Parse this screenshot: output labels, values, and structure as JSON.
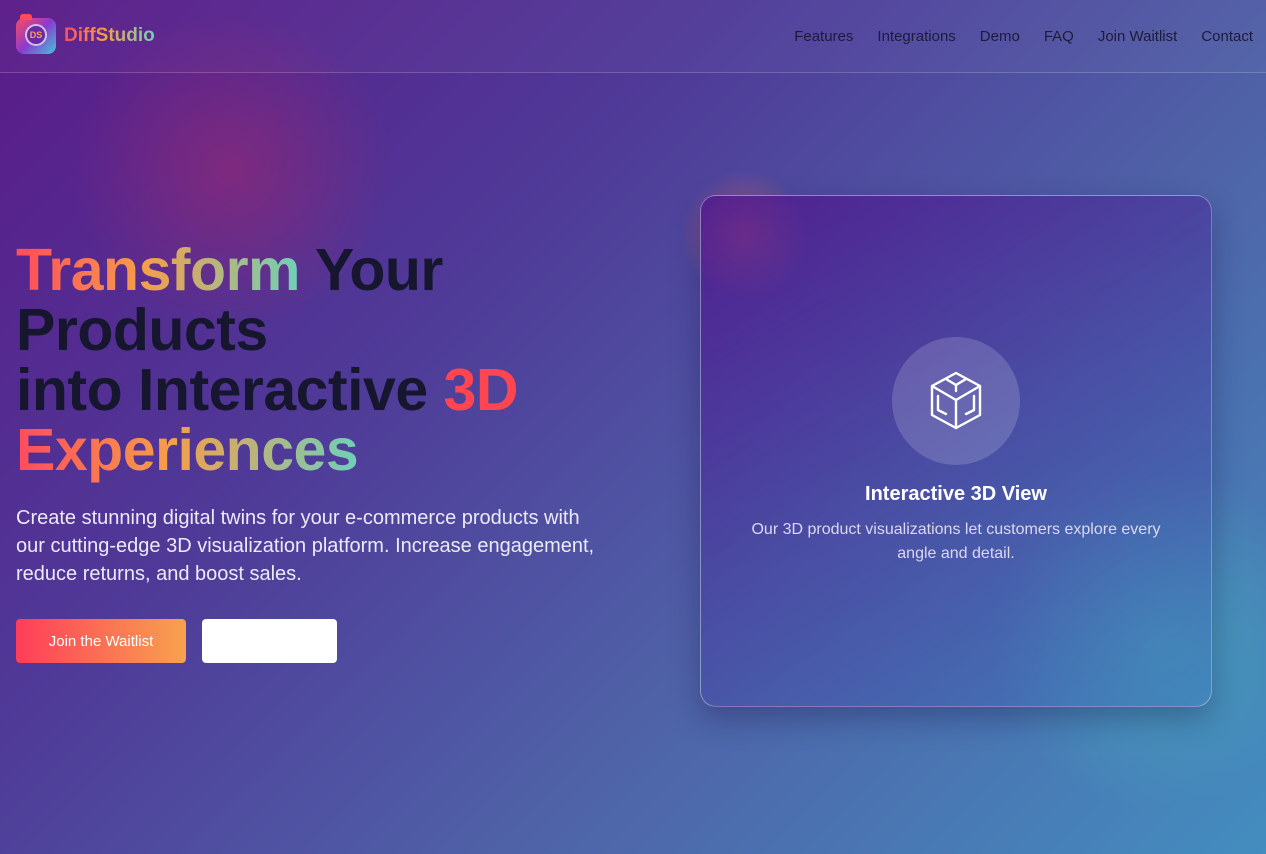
{
  "brand": {
    "logo_text": "DS",
    "name": "DiffStudio"
  },
  "nav": {
    "items": [
      "Features",
      "Integrations",
      "Demo",
      "FAQ",
      "Join Waitlist",
      "Contact"
    ]
  },
  "hero": {
    "title_part1": "Transform",
    "title_part2": " Your Products",
    "title_part3": "into Interactive ",
    "title_part4": "3D",
    "title_part5": "Experiences",
    "subtitle": "Create stunning digital twins for your e-commerce products with our cutting-edge 3D visualization platform. Increase engagement, reduce returns, and boost sales.",
    "primary_button": "Join the Waitlist",
    "secondary_button": ""
  },
  "card": {
    "icon": "cube-icon",
    "title": "Interactive 3D View",
    "description": "Our 3D product visualizations let customers explore every angle and detail."
  },
  "colors": {
    "accent_red": "#ff4650",
    "accent_orange": "#f59e4a",
    "accent_teal": "#6fd0b8",
    "heading_dark": "#16162e"
  }
}
